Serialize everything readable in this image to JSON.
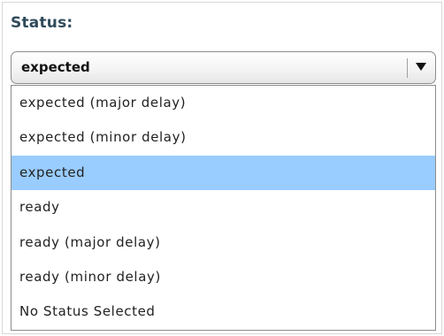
{
  "field": {
    "label": "Status:"
  },
  "select": {
    "value": "expected",
    "icon": "chevron-down-icon"
  },
  "options": [
    {
      "label": "expected (major delay)",
      "selected": false
    },
    {
      "label": "expected (minor delay)",
      "selected": false
    },
    {
      "label": "expected",
      "selected": true
    },
    {
      "label": "ready",
      "selected": false
    },
    {
      "label": "ready (major delay)",
      "selected": false
    },
    {
      "label": "ready (minor delay)",
      "selected": false
    },
    {
      "label": "No Status Selected",
      "selected": false
    }
  ],
  "colors": {
    "highlight": "#99ccff",
    "label_text": "#2f4a5a",
    "option_text": "#222222"
  }
}
